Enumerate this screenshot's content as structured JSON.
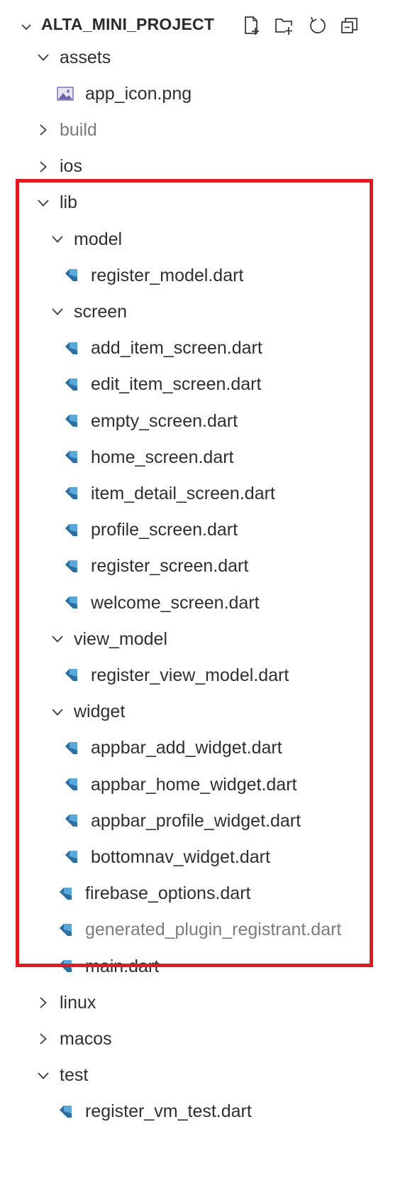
{
  "explorer": {
    "project_title": "ALTA_MINI_PROJECT",
    "actions": [
      {
        "icon": "new-file-icon"
      },
      {
        "icon": "new-folder-icon"
      },
      {
        "icon": "refresh-icon"
      },
      {
        "icon": "collapse-all-icon"
      }
    ]
  },
  "tree": [
    {
      "label": "assets",
      "kind": "folder",
      "expanded": true,
      "depth": 0
    },
    {
      "label": "app_icon.png",
      "kind": "image",
      "depth": 1
    },
    {
      "label": "build",
      "kind": "folder",
      "expanded": false,
      "dimmed": true,
      "depth": 0
    },
    {
      "label": "ios",
      "kind": "folder",
      "expanded": false,
      "depth": 0
    },
    {
      "label": "lib",
      "kind": "folder",
      "expanded": true,
      "depth": 0
    },
    {
      "label": "model",
      "kind": "folder",
      "expanded": true,
      "depth": 1
    },
    {
      "label": "register_model.dart",
      "kind": "dart",
      "depth": 2
    },
    {
      "label": "screen",
      "kind": "folder",
      "expanded": true,
      "depth": 1
    },
    {
      "label": "add_item_screen.dart",
      "kind": "dart",
      "depth": 2
    },
    {
      "label": "edit_item_screen.dart",
      "kind": "dart",
      "depth": 2
    },
    {
      "label": "empty_screen.dart",
      "kind": "dart",
      "depth": 2
    },
    {
      "label": "home_screen.dart",
      "kind": "dart",
      "depth": 2
    },
    {
      "label": "item_detail_screen.dart",
      "kind": "dart",
      "depth": 2
    },
    {
      "label": "profile_screen.dart",
      "kind": "dart",
      "depth": 2
    },
    {
      "label": "register_screen.dart",
      "kind": "dart",
      "depth": 2
    },
    {
      "label": "welcome_screen.dart",
      "kind": "dart",
      "depth": 2
    },
    {
      "label": "view_model",
      "kind": "folder",
      "expanded": true,
      "depth": 1
    },
    {
      "label": "register_view_model.dart",
      "kind": "dart",
      "depth": 2
    },
    {
      "label": "widget",
      "kind": "folder",
      "expanded": true,
      "depth": 1
    },
    {
      "label": "appbar_add_widget.dart",
      "kind": "dart",
      "depth": 2
    },
    {
      "label": "appbar_home_widget.dart",
      "kind": "dart",
      "depth": 2
    },
    {
      "label": "appbar_profile_widget.dart",
      "kind": "dart",
      "depth": 2
    },
    {
      "label": "bottomnav_widget.dart",
      "kind": "dart",
      "depth": 2
    },
    {
      "label": "firebase_options.dart",
      "kind": "dart",
      "depth": 1
    },
    {
      "label": "generated_plugin_registrant.dart",
      "kind": "dart",
      "dimmed": true,
      "depth": 1
    },
    {
      "label": "main.dart",
      "kind": "dart",
      "depth": 1
    },
    {
      "label": "linux",
      "kind": "folder",
      "expanded": false,
      "depth": 0
    },
    {
      "label": "macos",
      "kind": "folder",
      "expanded": false,
      "depth": 0
    },
    {
      "label": "test",
      "kind": "folder",
      "expanded": true,
      "depth": 0
    },
    {
      "label": "register_vm_test.dart",
      "kind": "dart",
      "depth": 1
    }
  ],
  "colors": {
    "highlight_border": "#e01b23",
    "dart_icon_dark": "#2b6fa3",
    "dart_icon_light": "#5aa7d9",
    "text": "#2f2f2f",
    "dimmed_text": "#7c7c7c"
  }
}
